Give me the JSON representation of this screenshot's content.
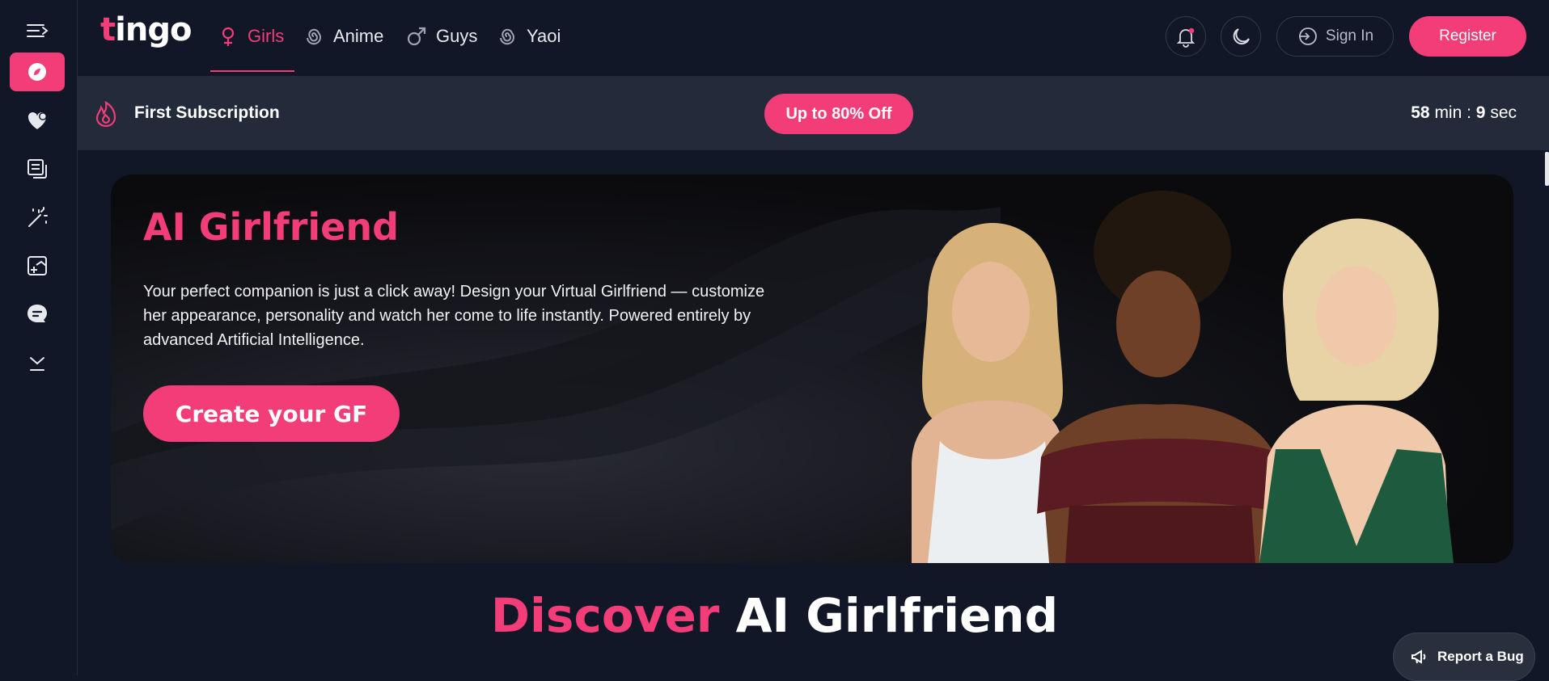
{
  "brand": {
    "logo_text_first": "t",
    "logo_text_rest": "ingo",
    "accent": "#f23d78"
  },
  "nav": {
    "tabs": [
      {
        "label": "Girls",
        "icon": "female-icon",
        "active": true
      },
      {
        "label": "Anime",
        "icon": "anime-spiral-icon",
        "active": false
      },
      {
        "label": "Guys",
        "icon": "male-icon",
        "active": false
      },
      {
        "label": "Yaoi",
        "icon": "yaoi-spiral-icon",
        "active": false
      }
    ],
    "sign_in_label": "Sign In",
    "register_label": "Register"
  },
  "sidebar": {
    "items": [
      {
        "icon": "menu-toggle-icon"
      },
      {
        "icon": "explore-icon",
        "active": true
      },
      {
        "icon": "heart-chat-icon"
      },
      {
        "icon": "gallery-icon"
      },
      {
        "icon": "magic-wand-icon"
      },
      {
        "icon": "create-image-icon"
      },
      {
        "icon": "chat-bubble-icon"
      },
      {
        "icon": "download-icon"
      }
    ]
  },
  "promo": {
    "title": "First Subscription",
    "offer_label": "Up to 80% Off",
    "timer": {
      "minutes": "58",
      "min_label": " min : ",
      "seconds": "9",
      "sec_label": " sec"
    }
  },
  "hero": {
    "title": "AI Girlfriend",
    "description": "Your perfect companion is just a click away! Design your Virtual Girlfriend — customize her appearance, personality and watch her come to life instantly. Powered entirely by advanced Artificial Intelligence.",
    "cta_label": "Create your GF"
  },
  "discover": {
    "highlight": "Discover",
    "rest": " AI Girlfriend"
  },
  "report_bug_label": "Report a Bug"
}
